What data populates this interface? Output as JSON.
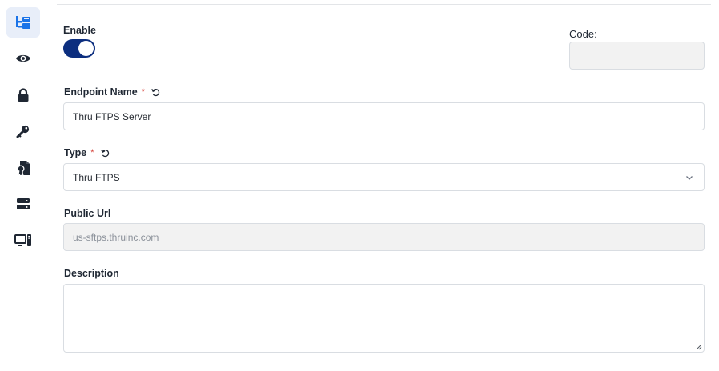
{
  "sidebar": {
    "items": [
      {
        "icon": "tree-structure-icon",
        "active": true
      },
      {
        "icon": "eye-icon",
        "active": false
      },
      {
        "icon": "lock-icon",
        "active": false
      },
      {
        "icon": "key-icon",
        "active": false
      },
      {
        "icon": "certificate-document-icon",
        "active": false
      },
      {
        "icon": "server-icon",
        "active": false
      },
      {
        "icon": "computer-icon",
        "active": false
      }
    ]
  },
  "form": {
    "enable": {
      "label": "Enable",
      "checked": true
    },
    "code": {
      "label": "Code:",
      "value": ""
    },
    "endpoint_name": {
      "label": "Endpoint Name",
      "required_mark": "*",
      "value": "Thru FTPS Server"
    },
    "type": {
      "label": "Type",
      "required_mark": "*",
      "selected": "Thru FTPS"
    },
    "public_url": {
      "label": "Public Url",
      "placeholder": "us-sftps.thruinc.com"
    },
    "description": {
      "label": "Description",
      "value": ""
    }
  },
  "colors": {
    "accent": "#0c2e7f",
    "active_nav_icon": "#1a73e8",
    "nav_icon": "#1f2733",
    "required": "#d6453d",
    "disabled_field": "#f2f2f2"
  }
}
